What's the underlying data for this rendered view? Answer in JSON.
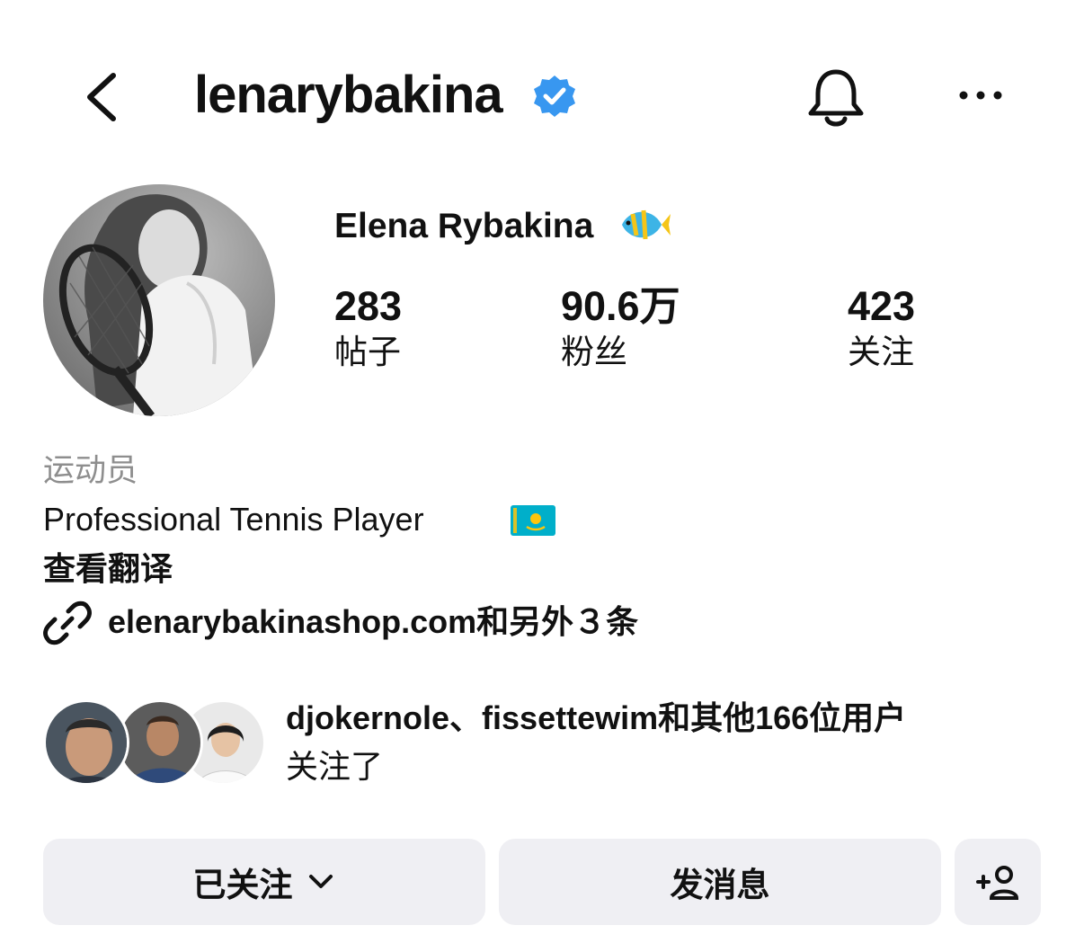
{
  "header": {
    "username": "lenarybakina",
    "back_icon": "chevron-left-icon",
    "verified_icon": "verified-badge-icon",
    "bell_icon": "bell-icon",
    "more_icon": "more-horizontal-icon"
  },
  "profile": {
    "display_name": "Elena Rybakina",
    "name_emoji_icon": "tropical-fish-icon",
    "stats": [
      {
        "value": "283",
        "label": "帖子"
      },
      {
        "value": "90.6万",
        "label": "粉丝"
      },
      {
        "value": "423",
        "label": "关注"
      }
    ],
    "category": "运动员",
    "bio": "Professional Tennis Player",
    "bio_flag_icon": "kazakhstan-flag-icon",
    "translate_label": "查看翻译",
    "link_text": "elenarybakinashop.com和另外３条",
    "link_icon": "link-icon"
  },
  "followed_by": {
    "names": "djokernole、fissettewim",
    "suffix": "和其他166位用户",
    "line2": "关注了"
  },
  "actions": {
    "following_label": "已关注",
    "message_label": "发消息",
    "add_user_icon": "add-user-icon",
    "dropdown_icon": "chevron-down-icon"
  },
  "colors": {
    "verified_blue": "#3897f0",
    "button_bg": "#efeff3",
    "muted_text": "#8e8e8e"
  }
}
